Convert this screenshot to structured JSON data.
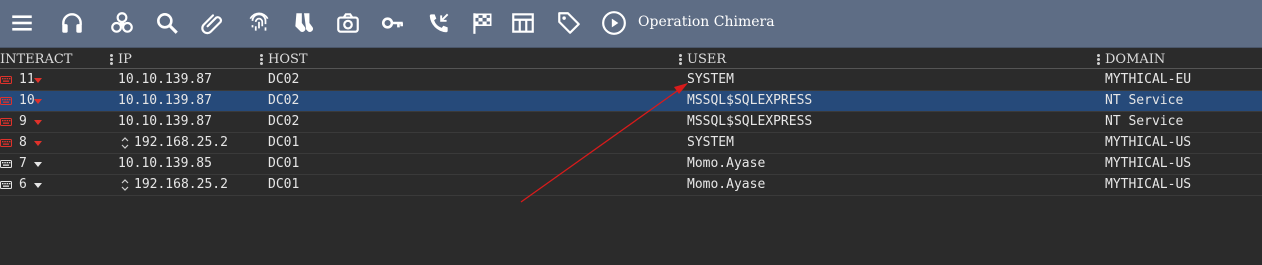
{
  "toolbar": {
    "operation_name": "Operation Chimera",
    "icons": [
      "menu-icon",
      "headphones-icon",
      "biohazard-icon",
      "search-icon",
      "paperclip-icon",
      "fingerprint-icon",
      "socks-icon",
      "camera-icon",
      "key-icon",
      "phone-callback-icon",
      "checkered-flag-icon",
      "table-icon",
      "tag-icon",
      "play-circle-icon"
    ]
  },
  "table": {
    "headers": {
      "interact": "INTERACT",
      "ip": "IP",
      "host": "HOST",
      "user": "USER",
      "domain": "DOMAIN"
    },
    "rows": [
      {
        "id": "11",
        "ip": "10.10.139.87",
        "host": "DC02",
        "user": "SYSTEM",
        "domain": "MYTHICAL-EU",
        "status": "high-integrity",
        "selected": false,
        "ip_sorted": false
      },
      {
        "id": "10",
        "ip": "10.10.139.87",
        "host": "DC02",
        "user": "MSSQL$SQLEXPRESS",
        "domain": "NT Service",
        "status": "high-integrity",
        "selected": true,
        "ip_sorted": false
      },
      {
        "id": "9",
        "ip": "10.10.139.87",
        "host": "DC02",
        "user": "MSSQL$SQLEXPRESS",
        "domain": "NT Service",
        "status": "high-integrity",
        "selected": false,
        "ip_sorted": false
      },
      {
        "id": "8",
        "ip": "192.168.25.2",
        "host": "DC01",
        "user": "SYSTEM",
        "domain": "MYTHICAL-US",
        "status": "high-integrity",
        "selected": false,
        "ip_sorted": true
      },
      {
        "id": "7",
        "ip": "10.10.139.85",
        "host": "DC01",
        "user": "Momo.Ayase",
        "domain": "MYTHICAL-US",
        "status": "normal",
        "selected": false,
        "ip_sorted": false
      },
      {
        "id": "6",
        "ip": "192.168.25.2",
        "host": "DC01",
        "user": "Momo.Ayase",
        "domain": "MYTHICAL-US",
        "status": "normal",
        "selected": false,
        "ip_sorted": true
      }
    ]
  },
  "colors": {
    "toolbar_bg": "#5e6d85",
    "high_integrity": "#e0322b",
    "normal": "#e6e6e6",
    "selected_row": "#264a7a",
    "annotation_arrow": "#d81b1b"
  }
}
